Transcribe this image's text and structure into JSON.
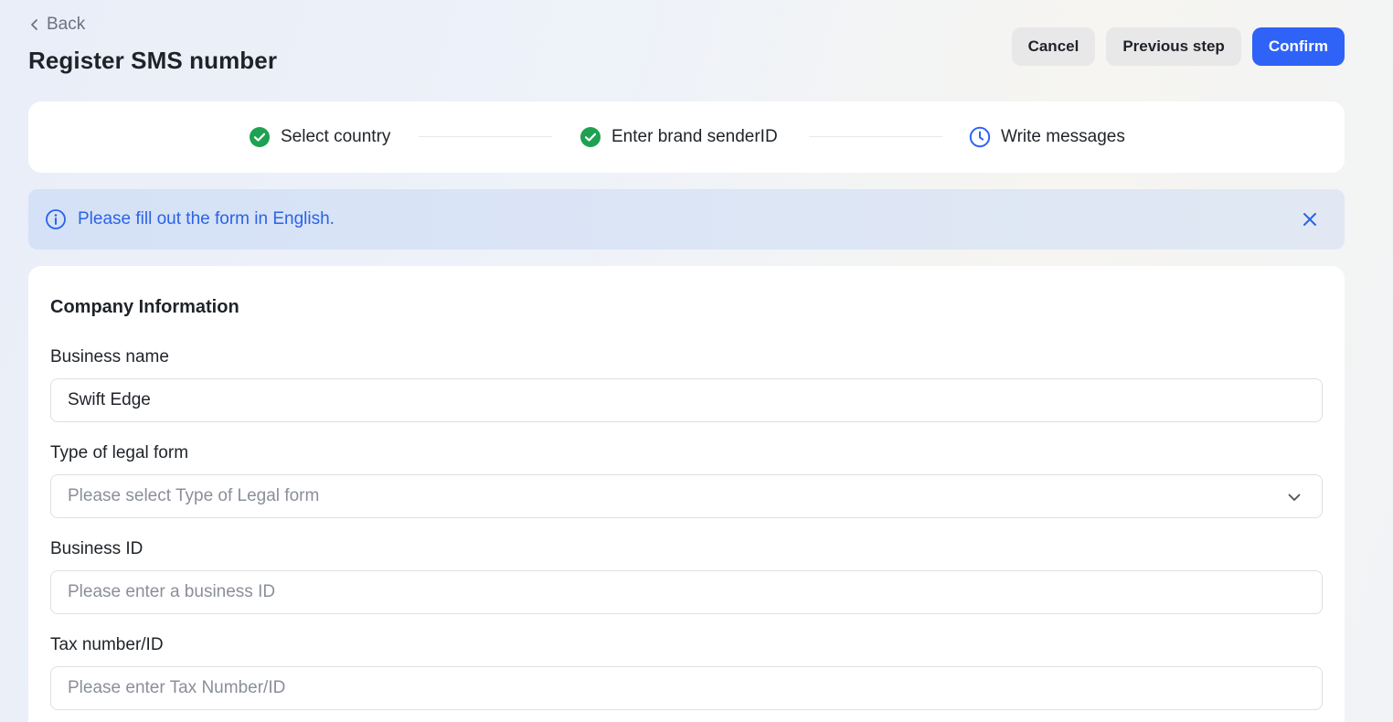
{
  "header": {
    "back_label": "Back",
    "title": "Register SMS number",
    "cancel_label": "Cancel",
    "previous_label": "Previous step",
    "confirm_label": "Confirm"
  },
  "steps": [
    {
      "label": "Select country",
      "status": "done",
      "icon": "check-circle-icon"
    },
    {
      "label": "Enter brand senderID",
      "status": "done",
      "icon": "check-circle-icon"
    },
    {
      "label": "Write messages",
      "status": "current",
      "icon": "clock-icon"
    }
  ],
  "banner": {
    "text": "Please fill out the form in English.",
    "icon": "info-icon"
  },
  "form": {
    "section_title": "Company Information",
    "business_name": {
      "label": "Business name",
      "value": "Swift Edge"
    },
    "legal_form": {
      "label": "Type of legal form",
      "placeholder": "Please select Type of Legal form"
    },
    "business_id": {
      "label": "Business ID",
      "placeholder": "Please enter a business ID",
      "value": ""
    },
    "tax_number": {
      "label": "Tax number/ID",
      "placeholder": "Please enter Tax Number/ID",
      "value": ""
    }
  },
  "colors": {
    "primary": "#2f62f6",
    "success": "#1ea152",
    "info_text": "#2b63e6"
  }
}
